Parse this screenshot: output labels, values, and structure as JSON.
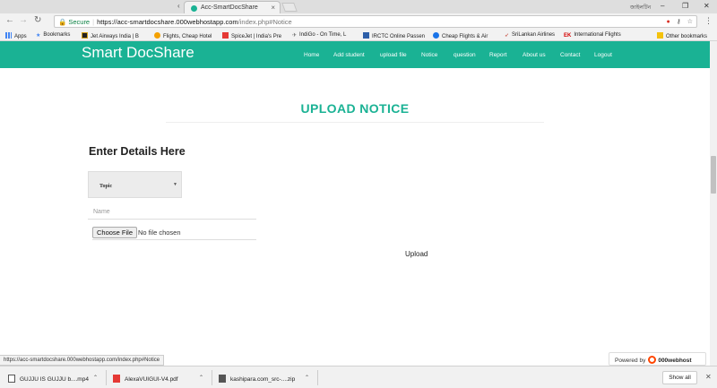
{
  "browser": {
    "tab_title": "Acc-SmartDocShare",
    "profile_name": "জাইলটিন",
    "secure_label": "Secure",
    "url_host": "https://acc-smartdocshare.000webhostapp.com",
    "url_path": "/index.php#Notice",
    "bookmarks": [
      {
        "label": "Apps",
        "icon": "apps-grid-icon",
        "color": "#4285f4"
      },
      {
        "label": "Bookmarks",
        "icon": "star-icon",
        "color": "#4285f4"
      },
      {
        "label": "Jet Airways India | B",
        "icon": "jet-airways-icon",
        "color": "#d4a017"
      },
      {
        "label": "Flights, Cheap Hotel",
        "icon": "flights-icon",
        "color": "#e53935"
      },
      {
        "label": "SpiceJet | India's Pre",
        "icon": "spicejet-icon",
        "color": "#e53935"
      },
      {
        "label": "IndiGo - On Time, L",
        "icon": "indigo-plane-icon",
        "color": "#666666"
      },
      {
        "label": "IRCTC Online Passen",
        "icon": "irctc-icon",
        "color": "#2d5fa8"
      },
      {
        "label": "Cheap Flights & Air",
        "icon": "globe-icon",
        "color": "#1a73e8"
      },
      {
        "label": "SriLankan Airlines",
        "icon": "srilankan-icon",
        "color": "#c0392b"
      },
      {
        "label": "International Flights",
        "icon": "ek-icon",
        "color": "#d50000"
      },
      {
        "label": "Other bookmarks",
        "icon": "folder-icon",
        "color": "#f4c20d"
      }
    ]
  },
  "site": {
    "brand": "Smart DocShare",
    "accent_color": "#1ab294",
    "nav": [
      "Home",
      "Add student",
      "upload file",
      "Notice",
      "question",
      "Report",
      "About us",
      "Contact",
      "Logout"
    ]
  },
  "form": {
    "page_title": "UPLOAD NOTICE",
    "heading": "Enter Details Here",
    "topic_label": "Topic",
    "name_placeholder": "Name",
    "choose_file_label": "Choose File",
    "no_file_label": "No file chosen",
    "upload_label": "Upload"
  },
  "status_bar": {
    "hover_url": "https://acc-smartdocshare.000webhostapp.com/index.php#Notice"
  },
  "powered_by": {
    "prefix": "Powered by",
    "name": "000webhost"
  },
  "downloads": {
    "items": [
      {
        "name": "GUJJU IS GUJJU b....mp4",
        "icon": "video-file-icon"
      },
      {
        "name": "AlexaVUIGUI-V4.pdf",
        "icon": "pdf-file-icon"
      },
      {
        "name": "kashipara.com_src-....zip",
        "icon": "zip-file-icon"
      }
    ],
    "show_all_label": "Show all"
  }
}
